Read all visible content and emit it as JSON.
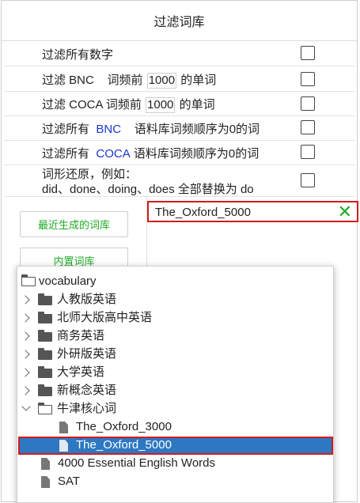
{
  "title": "过滤词库",
  "filters": {
    "all_numbers": "过滤所有数字",
    "bnc_prefix": "过滤 BNC",
    "bnc_mid": "词频前",
    "bnc_value": "1000",
    "bnc_suffix": "的单词",
    "coca_prefix": "过滤 COCA 词频前",
    "coca_value": "1000",
    "coca_suffix": "的单词",
    "bnc_zero_prefix": "过滤所有",
    "bnc_zero_corpus": "BNC",
    "bnc_zero_suffix": "语料库词频顺序为0的词",
    "coca_zero_prefix": "过滤所有",
    "coca_zero_corpus": "COCA",
    "coca_zero_suffix": "语料库词频顺序为0的词",
    "lemma_line1": "词形还原，例如：",
    "lemma_line2": "did、done、doing、does 全部替换为 do"
  },
  "buttons": {
    "recent": "最近生成的词库",
    "builtin": "内置词库"
  },
  "selected_input": {
    "value": "The_Oxford_5000",
    "clear_icon": "close-icon",
    "accent": "#1faa26"
  },
  "tree": {
    "root": "vocabulary",
    "folders": [
      "人教版英语",
      "北师大版高中英语",
      "商务英语",
      "外研版英语",
      "大学英语",
      "新概念英语"
    ],
    "open_folder": "牛津核心词",
    "open_children": [
      "The_Oxford_3000",
      "The_Oxford_5000"
    ],
    "files": [
      "4000 Essential English Words",
      "SAT"
    ],
    "selection_color": "#2d78c2",
    "highlight_color": "#d21b1b"
  }
}
